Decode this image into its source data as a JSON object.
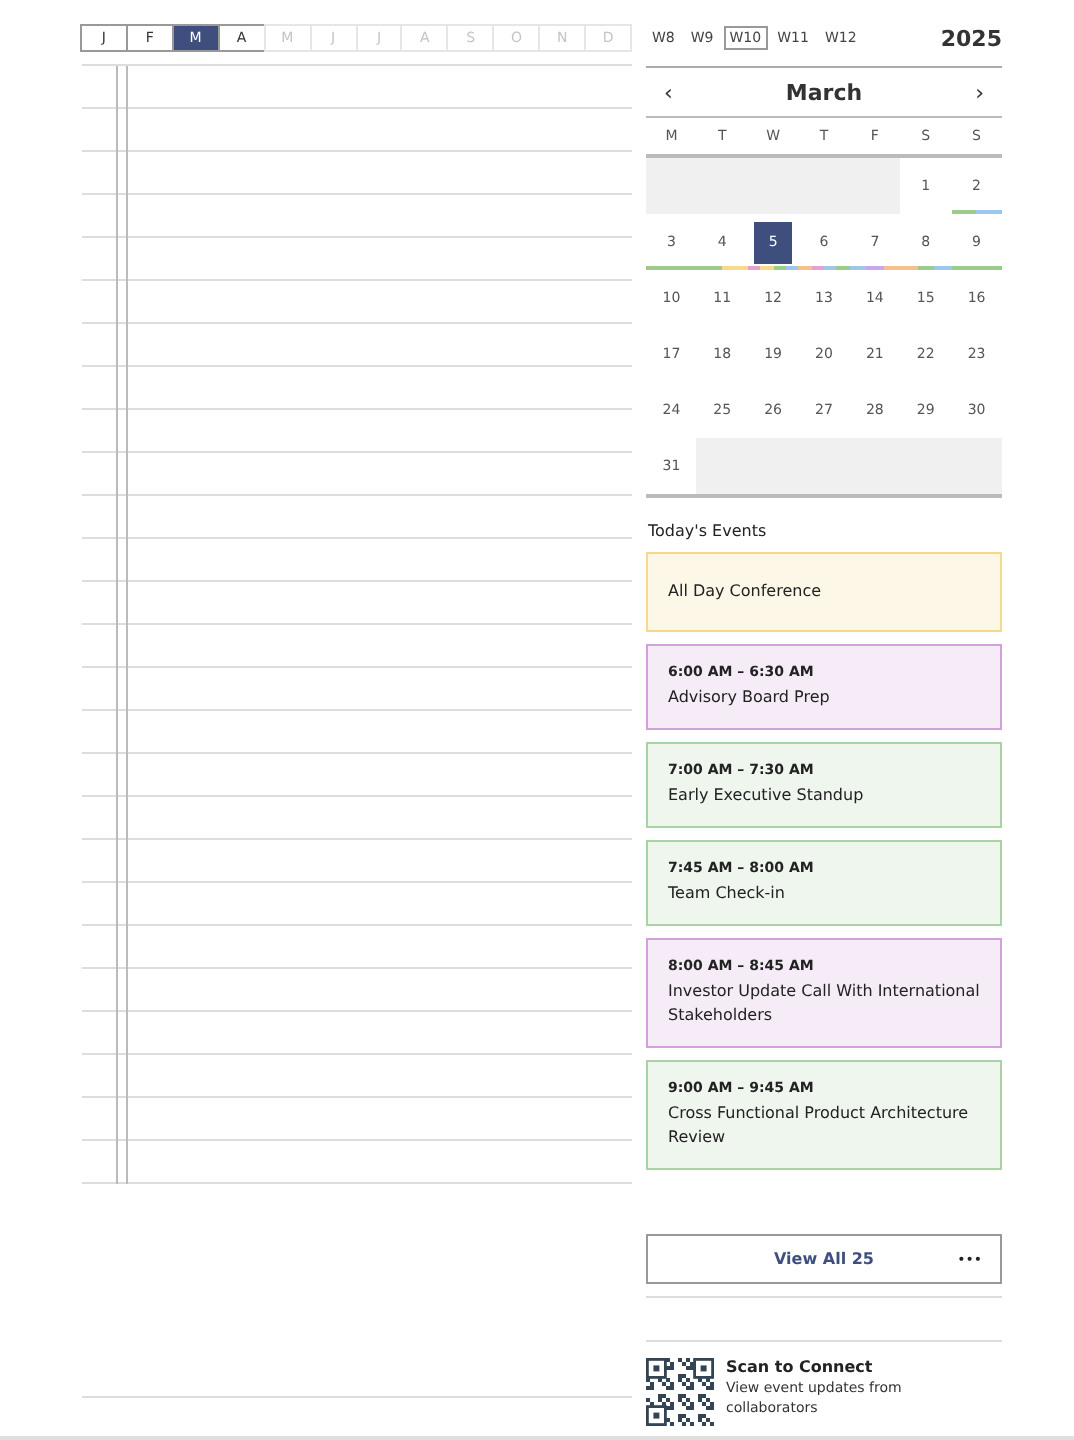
{
  "months": [
    {
      "label": "J",
      "selected": false,
      "disabled": false
    },
    {
      "label": "F",
      "selected": false,
      "disabled": false
    },
    {
      "label": "M",
      "selected": true,
      "disabled": false
    },
    {
      "label": "A",
      "selected": false,
      "disabled": false
    },
    {
      "label": "M",
      "selected": false,
      "disabled": true
    },
    {
      "label": "J",
      "selected": false,
      "disabled": true
    },
    {
      "label": "J",
      "selected": false,
      "disabled": true
    },
    {
      "label": "A",
      "selected": false,
      "disabled": true
    },
    {
      "label": "S",
      "selected": false,
      "disabled": true
    },
    {
      "label": "O",
      "selected": false,
      "disabled": true
    },
    {
      "label": "N",
      "selected": false,
      "disabled": true
    },
    {
      "label": "D",
      "selected": false,
      "disabled": true
    }
  ],
  "weeks": [
    {
      "label": "W8",
      "selected": false
    },
    {
      "label": "W9",
      "selected": false
    },
    {
      "label": "W10",
      "selected": true
    },
    {
      "label": "W11",
      "selected": false
    },
    {
      "label": "W12",
      "selected": false
    }
  ],
  "year": "2025",
  "calendar": {
    "prev": "‹",
    "month": "March",
    "next": "›",
    "weekdays": [
      "M",
      "T",
      "W",
      "T",
      "F",
      "S",
      "S"
    ],
    "rows": [
      [
        null,
        null,
        null,
        null,
        null,
        {
          "day": "1",
          "selected": false
        },
        {
          "day": "2",
          "selected": false,
          "markers": [
            {
              "color": "#9ccc8c"
            },
            {
              "color": "#9cc8ee"
            }
          ]
        }
      ],
      [
        {
          "day": "3",
          "selected": false,
          "markers": [
            {
              "color": "#9ccc8c"
            }
          ]
        },
        {
          "day": "4",
          "selected": false,
          "markers": [
            {
              "color": "#9ccc8c"
            },
            {
              "color": "#f6d98a"
            }
          ]
        },
        {
          "day": "5",
          "selected": true,
          "markers": [
            {
              "color": "#e6a0d0"
            },
            {
              "color": "#f6d98a"
            },
            {
              "color": "#9ccc8c"
            },
            {
              "color": "#9cc8ee"
            }
          ]
        },
        {
          "day": "6",
          "selected": false,
          "markers": [
            {
              "color": "#f6c08a"
            },
            {
              "color": "#e6a0d0"
            },
            {
              "color": "#9cc8ee"
            },
            {
              "color": "#9ccc8c"
            }
          ]
        },
        {
          "day": "7",
          "selected": false,
          "markers": [
            {
              "color": "#9cc8ee"
            },
            {
              "color": "#c8a8e8"
            },
            {
              "color": "#f6c08a"
            }
          ]
        },
        {
          "day": "8",
          "selected": false,
          "markers": [
            {
              "color": "#f6c08a"
            },
            {
              "color": "#9ccc8c"
            },
            {
              "color": "#9cc8ee"
            }
          ]
        },
        {
          "day": "9",
          "selected": false,
          "markers": [
            {
              "color": "#9ccc8c"
            }
          ]
        }
      ],
      [
        {
          "day": "10",
          "selected": false
        },
        {
          "day": "11",
          "selected": false
        },
        {
          "day": "12",
          "selected": false
        },
        {
          "day": "13",
          "selected": false
        },
        {
          "day": "14",
          "selected": false
        },
        {
          "day": "15",
          "selected": false
        },
        {
          "day": "16",
          "selected": false
        }
      ],
      [
        {
          "day": "17",
          "selected": false
        },
        {
          "day": "18",
          "selected": false
        },
        {
          "day": "19",
          "selected": false
        },
        {
          "day": "20",
          "selected": false
        },
        {
          "day": "21",
          "selected": false
        },
        {
          "day": "22",
          "selected": false
        },
        {
          "day": "23",
          "selected": false
        }
      ],
      [
        {
          "day": "24",
          "selected": false
        },
        {
          "day": "25",
          "selected": false
        },
        {
          "day": "26",
          "selected": false
        },
        {
          "day": "27",
          "selected": false
        },
        {
          "day": "28",
          "selected": false
        },
        {
          "day": "29",
          "selected": false
        },
        {
          "day": "30",
          "selected": false
        }
      ],
      [
        {
          "day": "31",
          "selected": false
        },
        null,
        null,
        null,
        null,
        null,
        null
      ]
    ]
  },
  "events_title": "Today's Events",
  "events": [
    {
      "title": "All Day Conference",
      "color": "#f6d98a"
    },
    {
      "time": "6:00 AM – 6:30 AM",
      "title": "Advisory Board Prep",
      "color": "#d4a0dc"
    },
    {
      "time": "7:00 AM – 7:30 AM",
      "title": "Early Executive Standup",
      "color": "#a8d4a4"
    },
    {
      "time": "7:45 AM – 8:00 AM",
      "title": "Team Check-in",
      "color": "#a8d4a4"
    },
    {
      "time": "8:00 AM – 8:45 AM",
      "title": "Investor Update Call With International Stakeholders",
      "color": "#d4a0dc"
    },
    {
      "time": "9:00 AM – 9:45 AM",
      "title": "Cross Functional Product Architecture Review",
      "color": "#a8d4a4"
    }
  ],
  "view_all": {
    "label": "View All 25",
    "more": "•••"
  },
  "qr": {
    "title": "Scan to Connect",
    "text": "View event updates from collaborators"
  }
}
